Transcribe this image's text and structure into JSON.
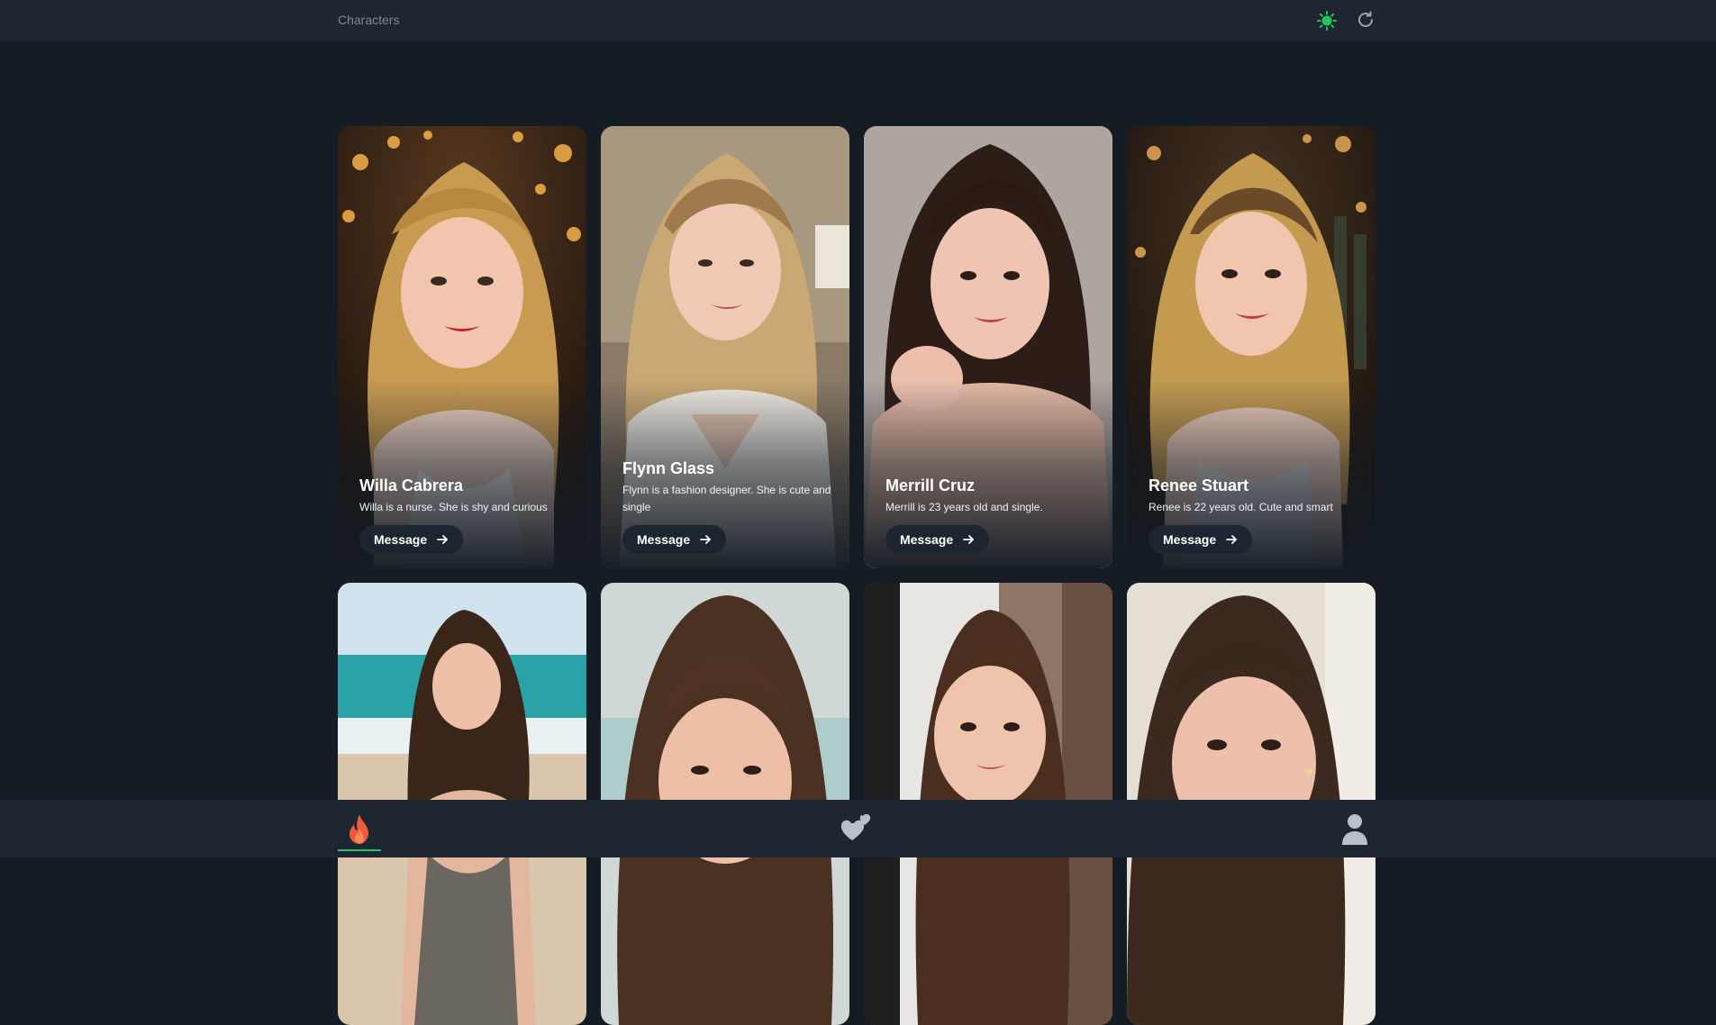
{
  "header": {
    "title": "Characters"
  },
  "accent_color": "#22c55e",
  "icons": {
    "status": "sun-status-icon",
    "refresh": "refresh-icon",
    "discover": "flame-icon",
    "favorites": "hearts-icon",
    "profile": "person-icon",
    "message_arrow": "arrow-right-icon"
  },
  "characters": [
    {
      "name": "Willa Cabrera",
      "description": "Willa is a nurse. She is shy and curious",
      "button": "Message"
    },
    {
      "name": "Flynn Glass",
      "description": "Flynn is a fashion designer. She is cute and single",
      "button": "Message"
    },
    {
      "name": "Merrill Cruz",
      "description": "Merrill is 23 years old and single.",
      "button": "Message"
    },
    {
      "name": "Renee Stuart",
      "description": "Renee is 22 years old. Cute and smart",
      "button": "Message"
    }
  ]
}
